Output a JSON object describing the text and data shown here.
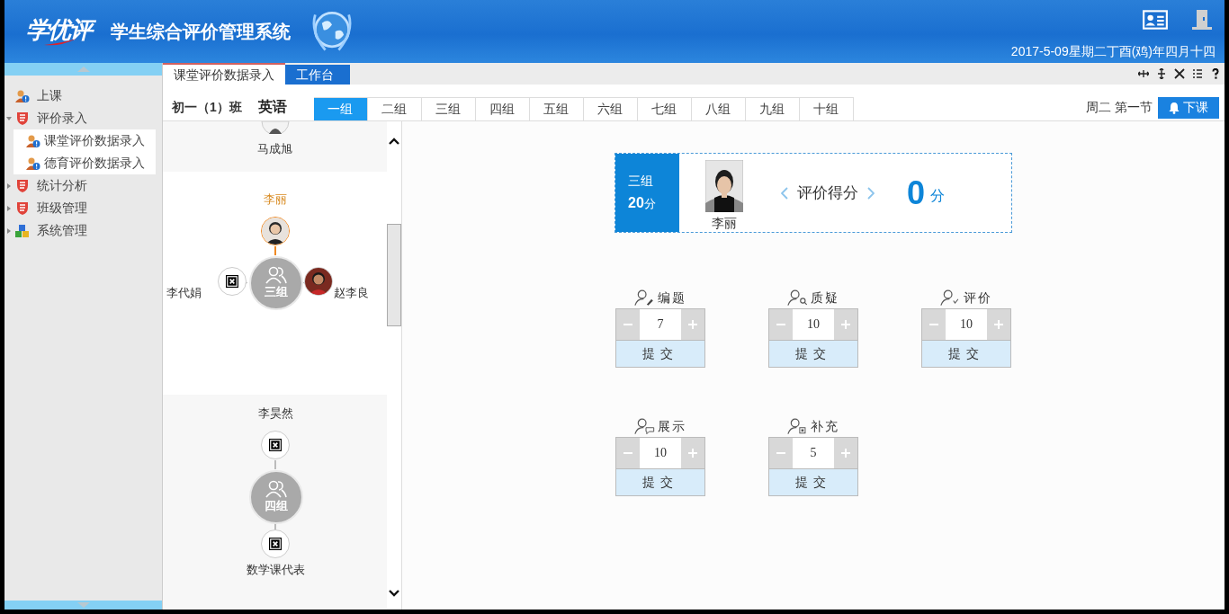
{
  "header": {
    "logo": "学优评",
    "title": "学生综合评价管理系统",
    "date": "2017-5-09星期二丁酉(鸡)年四月十四"
  },
  "sidebar": {
    "items": [
      {
        "label": "上课",
        "kind": "user"
      },
      {
        "label": "评价录入",
        "kind": "shield",
        "expanded": true,
        "children": [
          {
            "label": "课堂评价数据录入"
          },
          {
            "label": "德育评价数据录入"
          }
        ]
      },
      {
        "label": "统计分析",
        "kind": "shield",
        "expanded": false
      },
      {
        "label": "班级管理",
        "kind": "shield",
        "expanded": false
      },
      {
        "label": "系统管理",
        "kind": "blocks",
        "expanded": false
      }
    ]
  },
  "page_tabs": [
    {
      "label": "课堂评价数据录入",
      "selected": true
    },
    {
      "label": "工作台",
      "selected": false
    }
  ],
  "class_bar": {
    "class_name": "初一（1）班",
    "subject": "英语",
    "groups": [
      {
        "label": "一组",
        "selected": true
      },
      {
        "label": "二组",
        "selected": false
      },
      {
        "label": "三组",
        "selected": false
      },
      {
        "label": "四组",
        "selected": false
      },
      {
        "label": "五组",
        "selected": false
      },
      {
        "label": "六组",
        "selected": false
      },
      {
        "label": "七组",
        "selected": false
      },
      {
        "label": "八组",
        "selected": false
      },
      {
        "label": "九组",
        "selected": false
      },
      {
        "label": "十组",
        "selected": false
      }
    ],
    "period": "周二 第一节",
    "end_button": "下课"
  },
  "roster": {
    "top_member": {
      "name": "马成旭"
    },
    "groups": [
      {
        "name": "三组",
        "highlighted": true,
        "leader": {
          "name": "李丽"
        },
        "members": [
          {
            "name": "李代娟",
            "kind": "missing"
          },
          {
            "name": "赵李良"
          }
        ]
      },
      {
        "name": "四组",
        "highlighted": false,
        "leader": {
          "name": "李昊然",
          "kind": "missing"
        },
        "members": [
          {
            "name": "数学课代表",
            "kind": "missing"
          }
        ]
      }
    ]
  },
  "score_card": {
    "group": "三组",
    "group_score": "20",
    "group_unit": "分",
    "student": "李丽",
    "label": "评价得分",
    "score": "0",
    "unit": "分"
  },
  "categories": [
    {
      "label": "编题",
      "kind": "edit",
      "value": "7",
      "submit": "提交"
    },
    {
      "label": "质疑",
      "kind": "question",
      "value": "10",
      "submit": "提交"
    },
    {
      "label": "评价",
      "kind": "review",
      "value": "10",
      "submit": "提交"
    },
    {
      "label": "展示",
      "kind": "show",
      "value": "10",
      "submit": "提交"
    },
    {
      "label": "补充",
      "kind": "supplement",
      "value": "5",
      "submit": "提交"
    }
  ]
}
